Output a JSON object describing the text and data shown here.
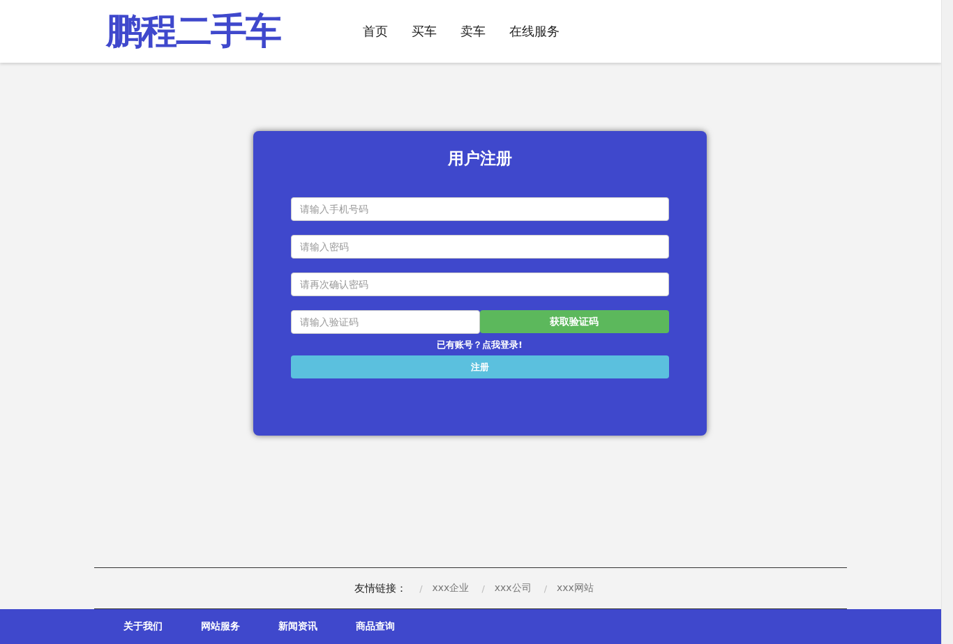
{
  "header": {
    "logo": "鹏程二手车",
    "nav": [
      {
        "label": "首页"
      },
      {
        "label": "买车"
      },
      {
        "label": "卖车"
      },
      {
        "label": "在线服务"
      }
    ]
  },
  "register": {
    "title": "用户注册",
    "fields": [
      {
        "placeholder": "请输入手机号码"
      },
      {
        "placeholder": "请输入密码"
      },
      {
        "placeholder": "请再次确认密码"
      }
    ],
    "code_field": {
      "placeholder": "请输入验证码"
    },
    "code_button": "获取验证码",
    "login_link": "已有账号？点我登录!",
    "submit_button": "注册"
  },
  "friend_links": {
    "label": "友情链接：",
    "links": [
      {
        "separator": "/",
        "label": "xxx企业"
      },
      {
        "separator": "/",
        "label": "xxx公司"
      },
      {
        "separator": "/",
        "label": "xxx网站"
      }
    ]
  },
  "footer_nav": [
    {
      "label": "关于我们"
    },
    {
      "label": "网站服务"
    },
    {
      "label": "新闻资讯"
    },
    {
      "label": "商品查询"
    }
  ]
}
